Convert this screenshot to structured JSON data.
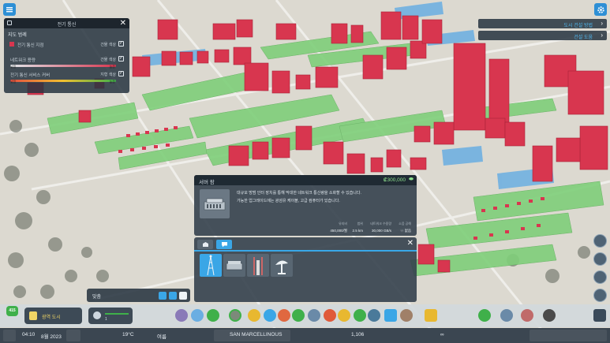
{
  "info_panel": {
    "title": "전기 통신",
    "subtitle": "지도 범례",
    "rows": [
      {
        "label": "전기 통신 지점",
        "right_label": "건물 색상",
        "checked": true,
        "bar_left": "",
        "bar_right": ""
      },
      {
        "label": "네트워크 용량",
        "right_label": "건물 색상",
        "checked": true,
        "bar_left": "낮음",
        "bar_right": "높음"
      },
      {
        "label": "전기 통신 서비스 커버",
        "right_label": "지형 색상",
        "checked": true,
        "bar_left": "낮음",
        "bar_right": "높음"
      }
    ],
    "close_label": "✕"
  },
  "top_right": {
    "nav1": "도시 건설 방법",
    "nav2": "건설 도움",
    "arrow": "›"
  },
  "detail": {
    "title": "서버 팜",
    "price": "₡300,000",
    "desc1": "대규모 방범 인터 장치를 통해 막대한 네트워크 통신량을 소화할 수 있습니다.",
    "desc2": "가능한 업그레이드에는 광섬유 케이블, 고급 컴퓨터가 있습니다.",
    "stats": [
      {
        "key": "유지비",
        "value": "450,000/월"
      },
      {
        "key": "범위",
        "value": "2.5 km"
      },
      {
        "key": "네트워크 수용량",
        "value": "30,000 GB/s"
      },
      {
        "key": "소음 공해",
        "value": "↑↑ 없음"
      }
    ]
  },
  "picker": {
    "close_label": "✕",
    "assets": [
      "송신탑",
      "서버 팜",
      "송신탑 2",
      "위성 안테나"
    ]
  },
  "zone_panel": {
    "label": "맞춤"
  },
  "toolbar": {
    "population_badge": "415",
    "milestone_label": "광역 도시",
    "dev_value": "1"
  },
  "statusbar": {
    "time": "04:10",
    "date": "8월 2023",
    "temperature": "19°C",
    "season": "여름",
    "city_name": "SAN MARCELLINOUS",
    "population": "1,106",
    "money": "∞"
  },
  "colors": {
    "accent": "#2d8fd5",
    "building": "#d8364f",
    "zone_green": "#6cc46c",
    "zone_blue": "#6aaee2",
    "money_green": "#8fe28f"
  }
}
